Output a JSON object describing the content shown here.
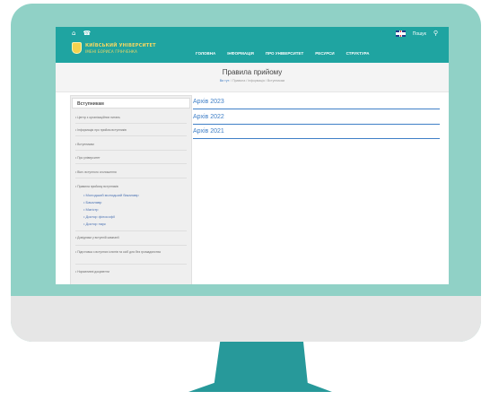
{
  "header": {
    "logo_line1": "КИЇВСЬКИЙ УНІВЕРСИТЕТ",
    "logo_line2": "ІМЕНІ БОРИСА ГРІНЧЕНКА",
    "utility_icons": [
      "building-icon",
      "phone-icon"
    ],
    "search_label": "Пошук",
    "nav": [
      "ГОЛОВНА",
      "ІНФОРМАЦІЯ",
      "ПРО УНІВЕРСИТЕТ",
      "РЕСУРСИ",
      "СТРУКТУРА"
    ],
    "color": "#1fa4a1",
    "logo_color": "#f5d761"
  },
  "page": {
    "title": "Правила прийому",
    "breadcrumb_home": "Ви тут:",
    "breadcrumb_rest": "/ Правила / Інформація / Вступникам"
  },
  "sidebar": {
    "title": "Вступникам",
    "items": [
      "• Центр з організаційних питань",
      "• Інформація про прийом вступників",
      "• Вступникам",
      "• Про університет",
      "• Вiкн. вступного оголошення",
      "• Правила прийому вступників",
      "• Довідники у вступній кампанії",
      "• Підготовка з вступних іспитів та осіб для без громадянства",
      "• Нормативні документи"
    ],
    "subitems": [
      "• Молодший молодший бакалавр",
      "• Бакалавр",
      "• Магістр",
      "• Доктор філософії",
      "• Доктор наук"
    ]
  },
  "content": {
    "links": [
      "Архів 2023",
      "Архів 2022",
      "Архів 2021"
    ],
    "link_color": "#3f7fc7"
  },
  "device": {
    "frame_color": "#90d1c6",
    "chin_color": "#e6e6e6",
    "stand_color": "#27999a"
  }
}
